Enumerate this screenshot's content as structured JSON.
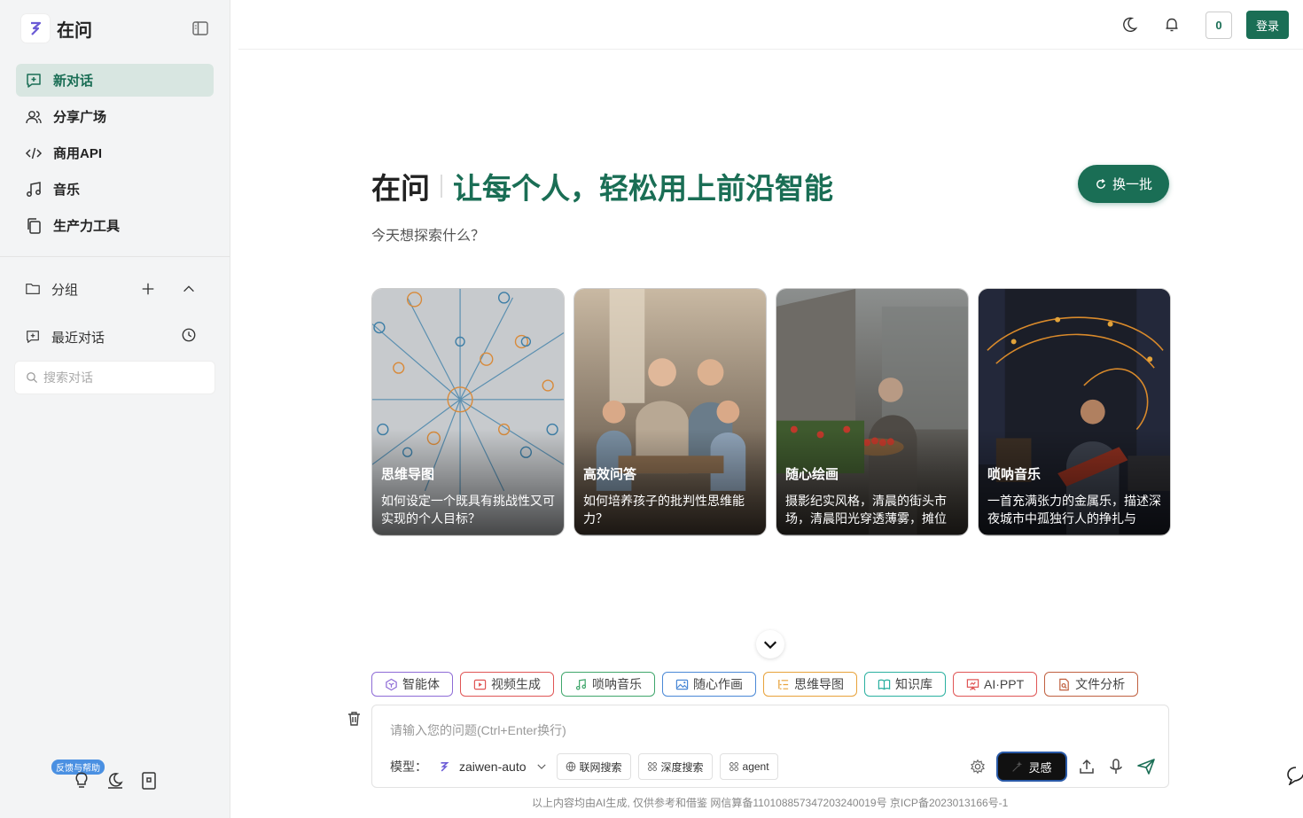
{
  "app": {
    "title": "在问"
  },
  "sidebar": {
    "nav": [
      {
        "label": "新对话",
        "icon": "new-chat-icon",
        "active": true
      },
      {
        "label": "分享广场",
        "icon": "users-icon"
      },
      {
        "label": "商用API",
        "icon": "code-icon"
      },
      {
        "label": "音乐",
        "icon": "music-icon"
      },
      {
        "label": "生产力工具",
        "icon": "copy-icon"
      }
    ],
    "group_label": "分组",
    "recent_label": "最近对话",
    "search_placeholder": "搜索对话",
    "feedback_badge": "反馈与帮助"
  },
  "topbar": {
    "counter": "0",
    "login_label": "登录"
  },
  "hero": {
    "brand": "在问",
    "slogan": "让每个人，轻松用上前沿智能",
    "subtitle": "今天想探索什么？",
    "refresh_label": "换一批"
  },
  "cards": [
    {
      "title": "思维导图",
      "desc": "如何设定一个既具有挑战性又可实现的个人目标？"
    },
    {
      "title": "高效问答",
      "desc": "如何培养孩子的批判性思维能力？"
    },
    {
      "title": "随心绘画",
      "desc": "摄影纪实风格，清晨的街头市场，清晨阳光穿透薄雾，摊位"
    },
    {
      "title": "唢呐音乐",
      "desc": "一首充满张力的金属乐，描述深夜城市中孤独行人的挣扎与"
    }
  ],
  "tools": [
    {
      "label": "智能体",
      "color": "#8e6bd6"
    },
    {
      "label": "视频生成",
      "color": "#e05555"
    },
    {
      "label": "唢呐音乐",
      "color": "#3fa66b"
    },
    {
      "label": "随心作画",
      "color": "#4a88d6"
    },
    {
      "label": "思维导图",
      "color": "#e8a23a"
    },
    {
      "label": "知识库",
      "color": "#2ab0a0"
    },
    {
      "label": "AI·PPT",
      "color": "#e05555"
    },
    {
      "label": "文件分析",
      "color": "#c06040"
    }
  ],
  "input": {
    "placeholder": "请输入您的问题(Ctrl+Enter换行)",
    "model_label": "模型：",
    "model_value": "zaiwen-auto",
    "chips": [
      "联网搜索",
      "深度搜索",
      "agent"
    ],
    "inspire_label": "灵感"
  },
  "footer": "以上内容均由AI生成, 仅供参考和借鉴 网信算备110108857347203240019号 京ICP备2023013166号-1"
}
